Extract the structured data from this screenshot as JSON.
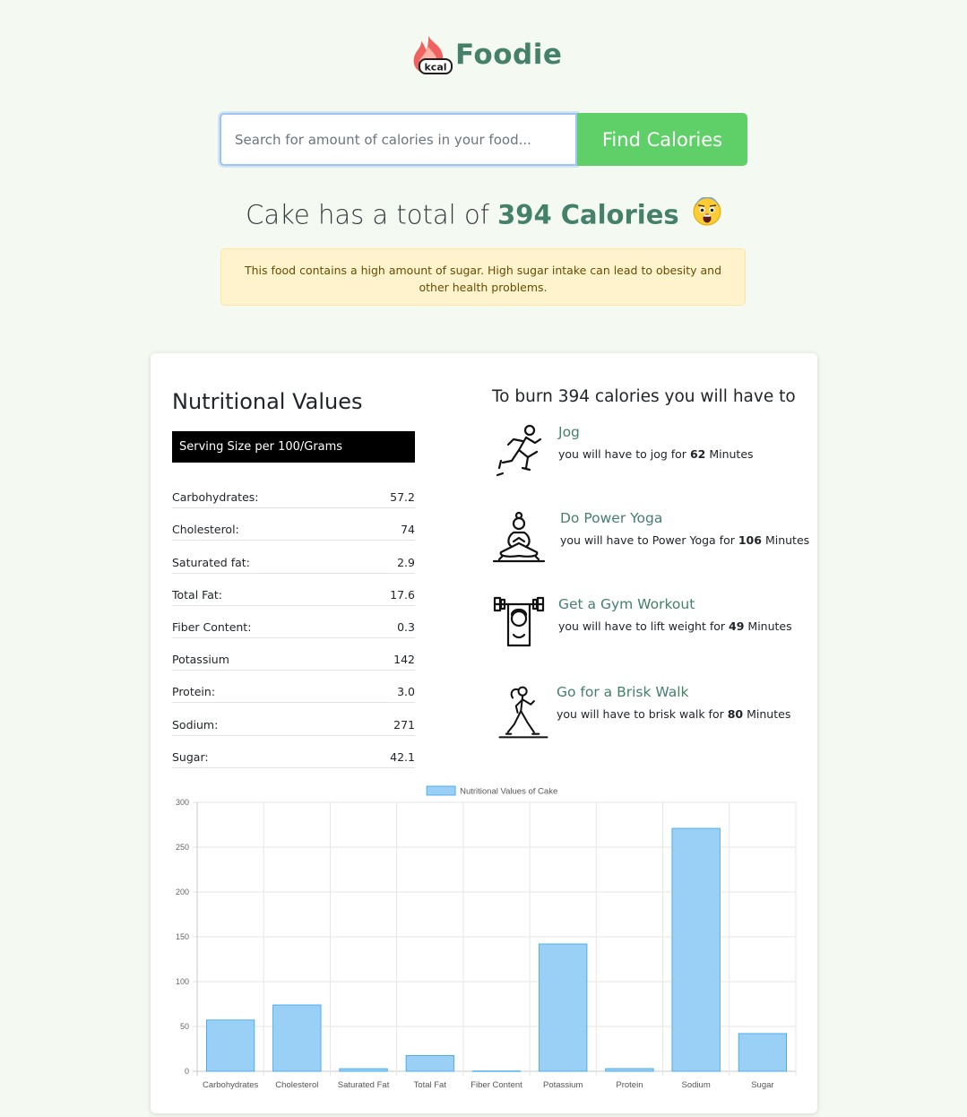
{
  "brand": {
    "name": "Foodie",
    "badge": "kcal"
  },
  "search": {
    "placeholder": "Search for amount of calories in your food...",
    "value": "",
    "button_label": "Find Calories"
  },
  "result": {
    "food": "Cake",
    "prefix": "has a total of",
    "calories_text": "394 Calories",
    "emoji": "fearful-face-icon"
  },
  "alert": {
    "text": "This food contains a high amount of sugar. High sugar intake can lead to obesity and other health problems."
  },
  "nutrition": {
    "title": "Nutritional Values",
    "serving": "Serving Size per 100/Grams",
    "rows": [
      {
        "label": "Carbohydrates:",
        "value": "57.2"
      },
      {
        "label": "Cholesterol:",
        "value": "74"
      },
      {
        "label": "Saturated fat:",
        "value": "2.9"
      },
      {
        "label": "Total Fat:",
        "value": "17.6"
      },
      {
        "label": "Fiber Content:",
        "value": "0.3"
      },
      {
        "label": "Potassium",
        "value": "142"
      },
      {
        "label": "Protein:",
        "value": "3.0"
      },
      {
        "label": "Sodium:",
        "value": "271"
      },
      {
        "label": "Sugar:",
        "value": "42.1"
      }
    ]
  },
  "burn": {
    "title": "To burn 394 calories you will have to",
    "exercises": [
      {
        "title": "Jog",
        "prefix": "you will have to jog for",
        "minutes": "62",
        "suffix": "Minutes",
        "icon": "jogging-icon"
      },
      {
        "title": "Do Power Yoga",
        "prefix": "you will have to Power Yoga for",
        "minutes": "106",
        "suffix": "Minutes",
        "icon": "yoga-icon"
      },
      {
        "title": "Get a Gym Workout",
        "prefix": "you will have to lift weight for",
        "minutes": "49",
        "suffix": "Minutes",
        "icon": "weightlifting-icon"
      },
      {
        "title": "Go for a Brisk Walk",
        "prefix": "you will have to brisk walk for",
        "minutes": "80",
        "suffix": "Minutes",
        "icon": "walking-icon"
      }
    ]
  },
  "colors": {
    "accent": "#44806a",
    "button": "#5fd068",
    "bar_fill": "#9ad0f5",
    "bar_stroke": "#36a2eb"
  },
  "chart_data": {
    "type": "bar",
    "categories": [
      "Carbohydrates",
      "Cholesterol",
      "Saturated Fat",
      "Total Fat",
      "Fiber Content",
      "Potassium",
      "Protein",
      "Sodium",
      "Sugar"
    ],
    "series": [
      {
        "name": "Nutritional Values of Cake",
        "values": [
          57.2,
          74,
          2.9,
          17.6,
          0.3,
          142,
          3.0,
          271,
          42.1
        ]
      }
    ],
    "ylim": [
      0,
      300
    ],
    "yticks": [
      0,
      50,
      100,
      150,
      200,
      250,
      300
    ],
    "grid": true,
    "legend": "top-center"
  }
}
